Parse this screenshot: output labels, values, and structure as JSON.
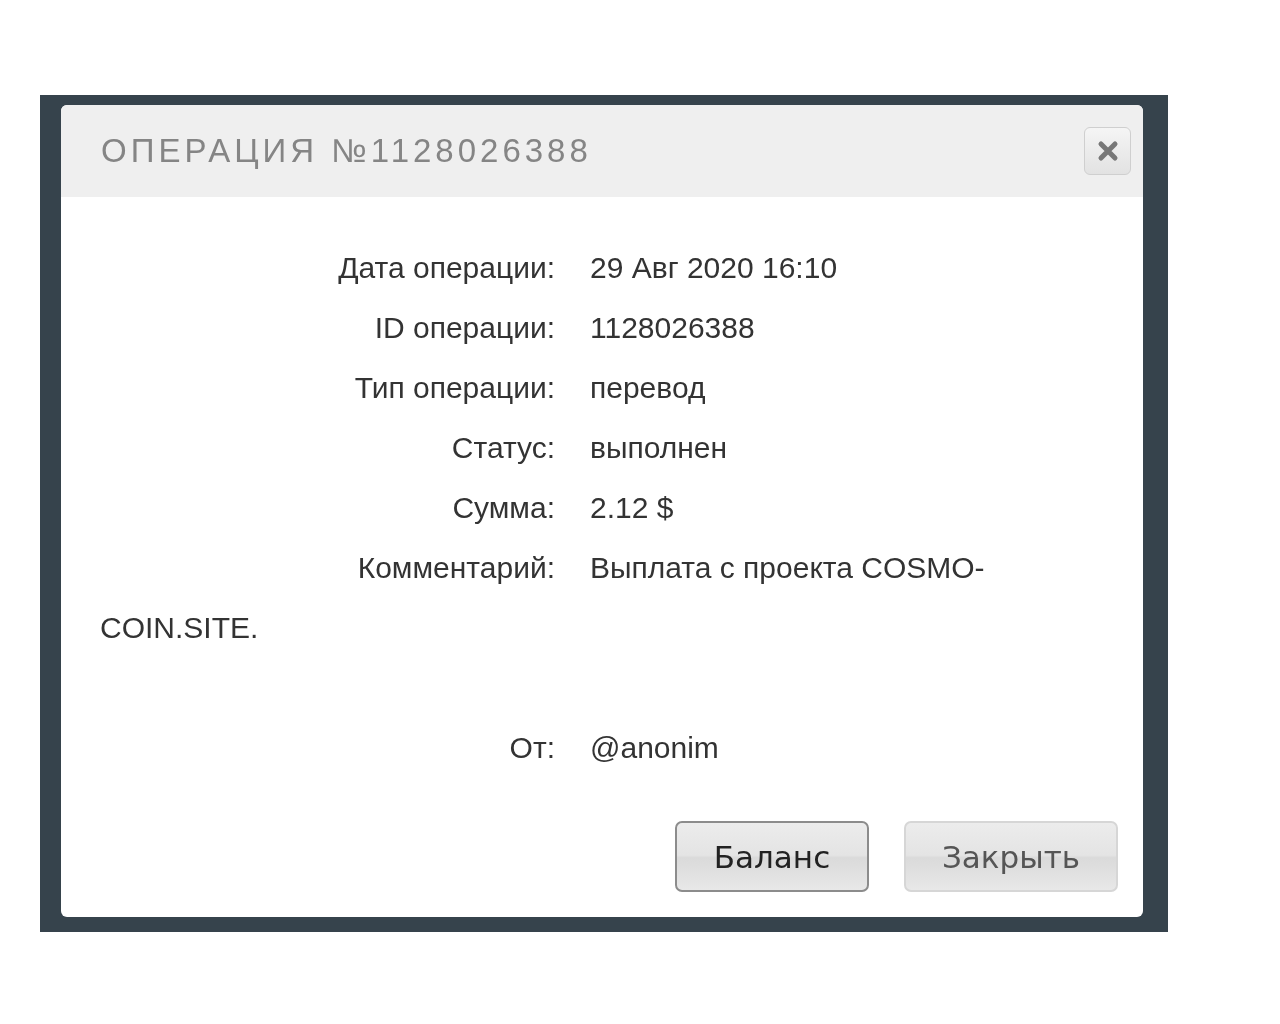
{
  "dialog": {
    "title": "ОПЕРАЦИЯ №1128026388",
    "fields": [
      {
        "label": "Дата операции:",
        "value": "29 Авг 2020 16:10"
      },
      {
        "label": "ID операции:",
        "value": "1128026388"
      },
      {
        "label": "Тип операции:",
        "value": "перевод"
      },
      {
        "label": "Статус:",
        "value": "выполнен"
      },
      {
        "label": "Сумма:",
        "value": "2.12 $"
      },
      {
        "label": "Комментарий:",
        "value": "Выплата с проекта COSMO-",
        "continuation": "COIN.SITE."
      },
      {
        "label": "От:",
        "value": "@anonim"
      }
    ],
    "buttons": [
      {
        "label": "Баланс",
        "default": true
      },
      {
        "label": "Закрыть",
        "default": false
      }
    ]
  }
}
